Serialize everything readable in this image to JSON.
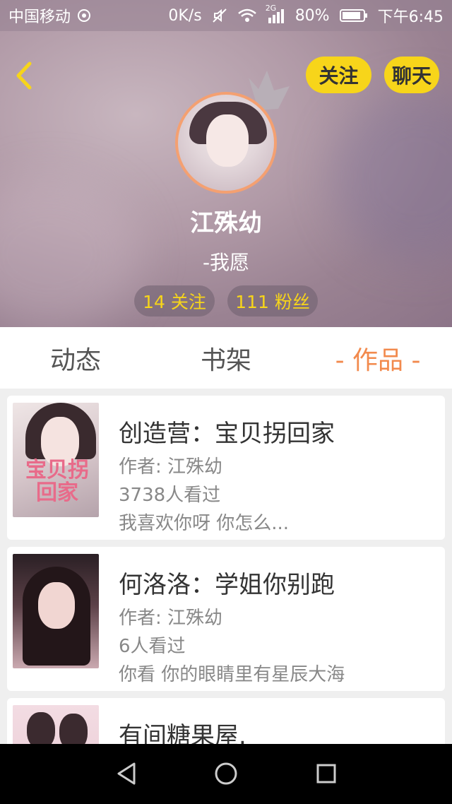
{
  "status_bar": {
    "carrier": "中国移动",
    "speed": "0K/s",
    "network": "2G",
    "battery": "80%",
    "time": "下午6:45"
  },
  "header": {
    "follow_button": "关注",
    "chat_button": "聊天",
    "name": "江殊幼",
    "signature": "-我愿",
    "following_stat": "14 关注",
    "fans_stat": "111 粉丝"
  },
  "tabs": {
    "feed": "动态",
    "shelf": "书架",
    "works": "- 作品 -"
  },
  "works": [
    {
      "title": "创造营：宝贝拐回家",
      "author": "作者: 江殊幼",
      "views": "3738人看过",
      "desc": "我喜欢你呀 你怎么...",
      "cover_text": "宝贝拐回家"
    },
    {
      "title": "何洛洛：学姐你别跑",
      "author": "作者: 江殊幼",
      "views": "6人看过",
      "desc": "你看 你的眼睛里有星辰大海"
    },
    {
      "title": "有间糖果屋."
    }
  ],
  "colors": {
    "accent_yellow": "#f7d51a",
    "accent_orange": "#f28a4d"
  }
}
